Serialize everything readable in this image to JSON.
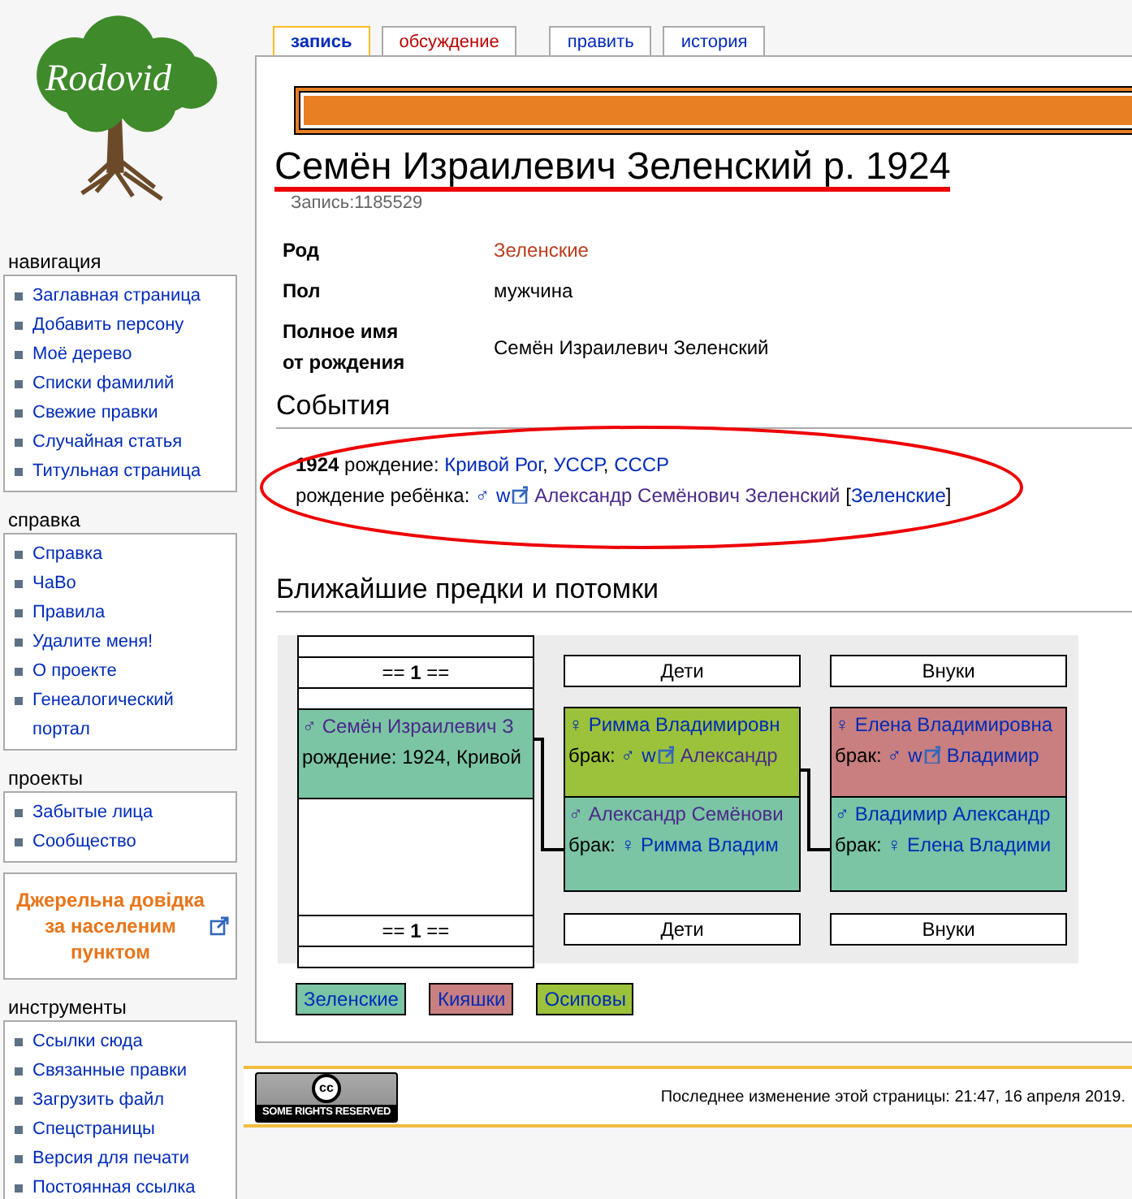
{
  "logo": {
    "text": "Rodovid"
  },
  "tab_groups": [
    [
      {
        "label": "запись",
        "selected": true,
        "missing": false
      },
      {
        "label": "обсуждение",
        "selected": false,
        "missing": true
      }
    ],
    [
      {
        "label": "править",
        "selected": false,
        "missing": false
      },
      {
        "label": "история",
        "selected": false,
        "missing": false
      }
    ]
  ],
  "sidebar": [
    {
      "kind": "list",
      "title": "навигация",
      "items": [
        "Заглавная страница",
        "Добавить персону",
        "Моё дерево",
        "Списки фамилий",
        "Свежие правки",
        "Случайная статья",
        "Титульная страница"
      ]
    },
    {
      "kind": "list",
      "title": "справка",
      "items": [
        "Справка",
        "ЧаВо",
        "Правила",
        "Удалите меня!",
        "О проекте",
        "Генеалогический портал"
      ]
    },
    {
      "kind": "list",
      "title": "проекты",
      "items": [
        "Забытые лица",
        "Сообщество"
      ]
    },
    {
      "kind": "promo",
      "text": "Джерельна довідка за населеним пунктом"
    },
    {
      "kind": "list",
      "title": "инструменты",
      "items": [
        "Ссылки сюда",
        "Связанные правки",
        "Загрузить файл",
        "Спецстраницы",
        "Версия для печати",
        "Постоянная ссылка"
      ]
    }
  ],
  "page": {
    "title": "Семён Израилевич Зеленский р. 1924",
    "record": "Запись:1185529",
    "infobox": [
      {
        "label": "Род",
        "value": "Зеленские",
        "kind": "link"
      },
      {
        "label": "Пол",
        "value": "мужчина",
        "kind": "text"
      },
      {
        "label": "Полное имя от рождения",
        "value": "Семён Израилевич Зеленский",
        "kind": "text"
      }
    ],
    "events_heading": "События",
    "events": [
      [
        {
          "kind": "bold",
          "text": "1924"
        },
        {
          "kind": "plain",
          "text": " рождение: "
        },
        {
          "kind": "link",
          "text": "Кривой Рог"
        },
        {
          "kind": "plain",
          "text": ", "
        },
        {
          "kind": "link",
          "text": "УССР"
        },
        {
          "kind": "plain",
          "text": ", "
        },
        {
          "kind": "link",
          "text": "СССР"
        }
      ],
      [
        {
          "kind": "plain",
          "text": "рождение ребёнка: "
        },
        {
          "kind": "link",
          "text": "♂"
        },
        {
          "kind": "wiki",
          "text": "w"
        },
        {
          "kind": "ext"
        },
        {
          "kind": "visited",
          "text": "Александр Семёнович Зеленский"
        },
        {
          "kind": "plain",
          "text": " ["
        },
        {
          "kind": "link",
          "text": "Зеленские"
        },
        {
          "kind": "plain",
          "text": "]"
        }
      ]
    ],
    "tree_heading": "Ближайшие предки и потомки",
    "tree": [
      {
        "kind": "root",
        "header": "== **1** ==",
        "footer": "== **1** ==",
        "cards": [
          {
            "color": "#7bc4a4",
            "lines": [
              [
                {
                  "kind": "visited",
                  "text": "♂ Семён Израилевич З"
                }
              ],
              [
                {
                  "kind": "plain",
                  "text": "рождение: 1924, Кривой"
                }
              ]
            ]
          }
        ]
      },
      {
        "kind": "generation",
        "header": "Дети",
        "footer": "Дети",
        "cards": [
          {
            "color": "#9bc23a",
            "lines": [
              [
                {
                  "kind": "link",
                  "text": "♀ Римма Владимировн"
                }
              ],
              [
                {
                  "kind": "plain",
                  "text": "брак: "
                },
                {
                  "kind": "link",
                  "text": "♂"
                },
                {
                  "kind": "wiki",
                  "text": "w"
                },
                {
                  "kind": "ext"
                },
                {
                  "kind": "visited",
                  "text": "Александр"
                }
              ]
            ]
          },
          {
            "color": "#7bc4a4",
            "lines": [
              [
                {
                  "kind": "visited",
                  "text": "♂ Александр Семёнови"
                }
              ],
              [
                {
                  "kind": "plain",
                  "text": "брак: "
                },
                {
                  "kind": "link",
                  "text": "♀ Римма Владим"
                }
              ]
            ]
          }
        ]
      },
      {
        "kind": "generation",
        "header": "Внуки",
        "footer": "Внуки",
        "cards": [
          {
            "color": "#c97f7f",
            "lines": [
              [
                {
                  "kind": "link",
                  "text": "♀ Елена Владимировна"
                }
              ],
              [
                {
                  "kind": "plain",
                  "text": "брак: "
                },
                {
                  "kind": "link",
                  "text": "♂"
                },
                {
                  "kind": "wiki",
                  "text": "w"
                },
                {
                  "kind": "ext"
                },
                {
                  "kind": "link",
                  "text": "Владимир"
                }
              ]
            ]
          },
          {
            "color": "#7bc4a4",
            "lines": [
              [
                {
                  "kind": "link",
                  "text": "♂ Владимир Александр"
                }
              ],
              [
                {
                  "kind": "plain",
                  "text": "брак: "
                },
                {
                  "kind": "link",
                  "text": "♀ Елена Владими"
                }
              ]
            ]
          }
        ]
      }
    ],
    "legend": [
      {
        "label": "Зеленские",
        "color": "#7bc4a4"
      },
      {
        "label": "Кияшки",
        "color": "#c97f7f"
      },
      {
        "label": "Осиповы",
        "color": "#9bc23a"
      }
    ]
  },
  "footer": {
    "badge_symbol": "cc",
    "badge_text": "SOME RIGHTS RESERVED",
    "last_modified": "Последнее изменение этой страницы: 21:47, 16 апреля 2019."
  }
}
